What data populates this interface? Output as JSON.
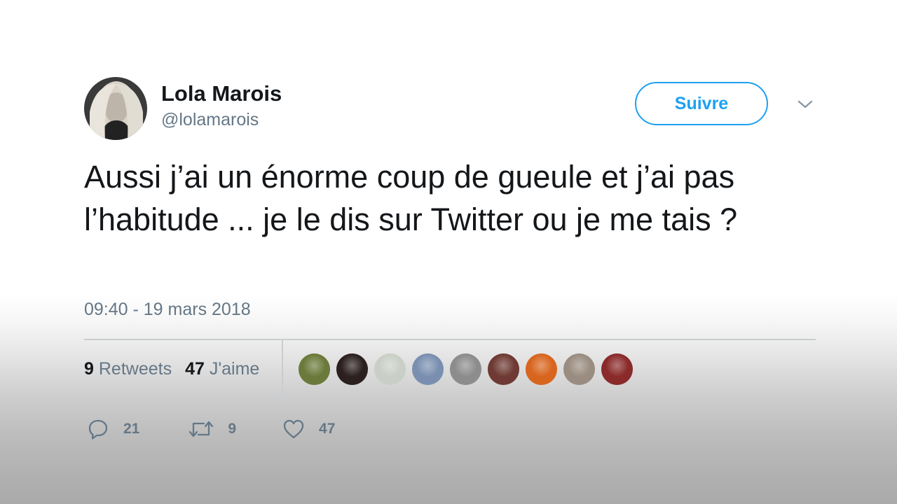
{
  "tweet": {
    "author": {
      "name": "Lola Marois",
      "handle": "@lolamarois"
    },
    "follow_label": "Suivre",
    "text": "Aussi j’ai un énorme coup de gueule et j’ai pas l’habitude ... je le dis sur Twitter ou je me tais ?",
    "timestamp": "09:40 - 19 mars 2018",
    "stats": {
      "retweets_count": "9",
      "retweets_label": "Retweets",
      "likes_count": "47",
      "likes_label": "J'aime"
    },
    "liker_avatars": [
      {
        "color": "#6b7a3a"
      },
      {
        "color": "#2b1f1f"
      },
      {
        "color": "#c9cfc6"
      },
      {
        "color": "#7a8fb0"
      },
      {
        "color": "#8c8c8c"
      },
      {
        "color": "#6e3a33"
      },
      {
        "color": "#d8651e"
      },
      {
        "color": "#9a8c80"
      },
      {
        "color": "#8a2a2a"
      }
    ],
    "actions": {
      "reply_count": "21",
      "retweet_count": "9",
      "like_count": "47"
    },
    "accent_color": "#1da1f2",
    "muted_color": "#657786"
  }
}
